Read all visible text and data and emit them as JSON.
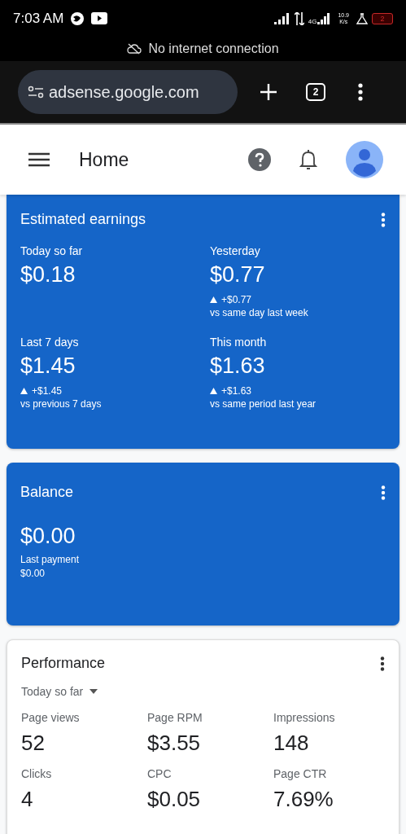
{
  "status_bar": {
    "time": "7:03 AM",
    "network": "4G",
    "speed": "10.9",
    "speed_unit": "K/s",
    "battery": "2"
  },
  "offline_banner": {
    "text": "No internet connection"
  },
  "browser": {
    "url": "adsense.google.com",
    "tab_count": "2"
  },
  "header": {
    "title": "Home"
  },
  "earnings": {
    "title": "Estimated earnings",
    "items": [
      {
        "label": "Today so far",
        "value": "$0.18"
      },
      {
        "label": "Yesterday",
        "value": "$0.77",
        "change": "+$0.77",
        "comparison": "vs same day last week"
      },
      {
        "label": "Last 7 days",
        "value": "$1.45",
        "change": "+$1.45",
        "comparison": "vs previous 7 days"
      },
      {
        "label": "This month",
        "value": "$1.63",
        "change": "+$1.63",
        "comparison": "vs same period last year"
      }
    ]
  },
  "balance": {
    "title": "Balance",
    "value": "$0.00",
    "last_payment_label": "Last payment",
    "last_payment": "$0.00"
  },
  "performance": {
    "title": "Performance",
    "period": "Today so far",
    "metrics": [
      {
        "label": "Page views",
        "value": "52"
      },
      {
        "label": "Page RPM",
        "value": "$3.55"
      },
      {
        "label": "Impressions",
        "value": "148"
      },
      {
        "label": "Clicks",
        "value": "4"
      },
      {
        "label": "CPC",
        "value": "$0.05"
      },
      {
        "label": "Page CTR",
        "value": "7.69%"
      }
    ]
  }
}
